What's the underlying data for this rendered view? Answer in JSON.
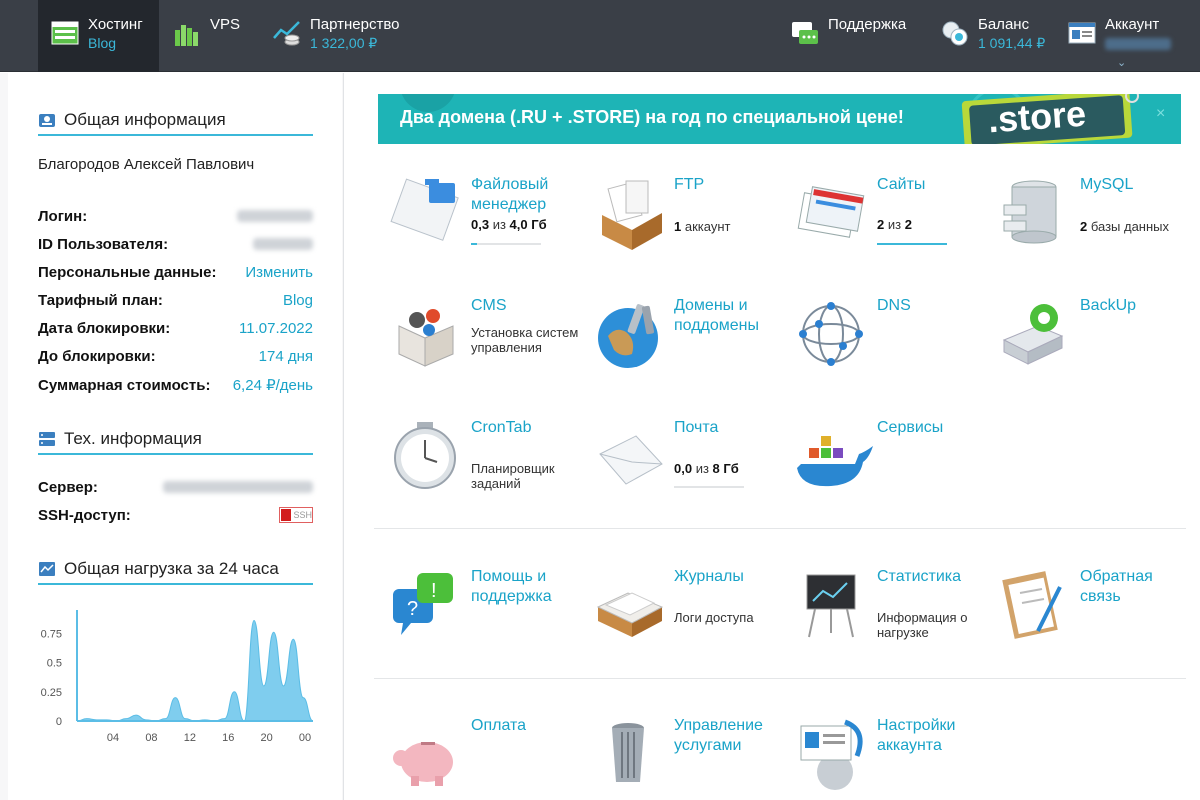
{
  "nav": {
    "hosting": {
      "title": "Хостинг",
      "sub": "Blog"
    },
    "vps": {
      "title": "VPS"
    },
    "partner": {
      "title": "Партнерство",
      "sub": "1 322,00 ₽"
    },
    "support": {
      "title": "Поддержка"
    },
    "balance": {
      "title": "Баланс",
      "sub": "1 091,44 ₽"
    },
    "account": {
      "title": "Аккаунт"
    }
  },
  "general": {
    "title": "Общая информация",
    "owner": "Благородов Алексей Павлович",
    "rows": [
      {
        "label": "Логин:",
        "value": ""
      },
      {
        "label": "ID Пользователя:",
        "value": ""
      },
      {
        "label": "Персональные данные:",
        "value": "Изменить"
      },
      {
        "label": "Тарифный план:",
        "value": "Blog"
      },
      {
        "label": "Дата блокировки:",
        "value": "11.07.2022"
      },
      {
        "label": "До блокировки:",
        "value": "174 дня"
      },
      {
        "label": "Суммарная стоимость:",
        "value": "6,24 ₽/день"
      }
    ]
  },
  "tech": {
    "title": "Тех. информация",
    "server_label": "Сервер:",
    "ssh_label": "SSH-доступ:",
    "ssh_badge": "SSH"
  },
  "load": {
    "title": "Общая нагрузка за 24 часа"
  },
  "chart_data": {
    "type": "area",
    "title": "Общая нагрузка за 24 часа",
    "x_ticks": [
      "04",
      "08",
      "12",
      "16",
      "20",
      "00"
    ],
    "y_ticks": [
      "0",
      "0.25",
      "0.5",
      "0.75"
    ],
    "ylim": [
      0,
      0.95
    ],
    "x": [
      0,
      1,
      2,
      3,
      4,
      5,
      6,
      7,
      8,
      9,
      10,
      11,
      12,
      13,
      14,
      15,
      16,
      17,
      18,
      19,
      20,
      21,
      22,
      23,
      24
    ],
    "values": [
      0,
      0.02,
      0.01,
      0.01,
      0.0,
      0.02,
      0.05,
      0.01,
      0.0,
      0.02,
      0.2,
      0.02,
      0.0,
      0.01,
      0.0,
      0.02,
      0.25,
      0.0,
      0.86,
      0.3,
      0.76,
      0.3,
      0.7,
      0.2,
      0
    ],
    "color": "#7fcdee"
  },
  "banner": {
    "text": "Два домена (.RU + .STORE) на год по специальной цене!",
    "badge": ".store"
  },
  "tiles": [
    {
      "title": "Файловый менеджер",
      "desc_b": "0,3",
      "desc": " из ",
      "desc_b2": "4,0 Гб",
      "usage": 0.08
    },
    {
      "title": "FTP",
      "desc_b": "1",
      "desc": " аккаунт"
    },
    {
      "title": "Сайты",
      "desc_b": "2",
      "desc": " из ",
      "desc_b2": "2",
      "usage": 1.0
    },
    {
      "title": "MySQL",
      "desc_b": "2",
      "desc": " базы данных"
    },
    {
      "title": "CMS",
      "desc": "Установка систем управления"
    },
    {
      "title": "Домены и поддомены"
    },
    {
      "title": "DNS"
    },
    {
      "title": "BackUp"
    },
    {
      "title": "CronTab",
      "desc": "Планировщик заданий"
    },
    {
      "title": "Почта",
      "desc_b": "0,0",
      "desc": " из ",
      "desc_b2": "8 Гб",
      "usage": 0.0
    },
    {
      "title": "Сервисы"
    },
    {
      "title": "Помощь и поддержка"
    },
    {
      "title": "Журналы",
      "desc": "Логи доступа"
    },
    {
      "title": "Статистика",
      "desc": "Информация о нагрузке"
    },
    {
      "title": "Обратная связь"
    },
    {
      "title": "Оплата"
    },
    {
      "title": "Управление услугами"
    },
    {
      "title": "Настройки аккаунта"
    }
  ],
  "colors": {
    "accent": "#3bb8d9",
    "topbar": "#3a3f47",
    "banner": "#1eb4b6"
  },
  "icons": [
    "hosting-icon",
    "vps-icon",
    "partner-icon",
    "support-icon",
    "balance-icon",
    "account-icon"
  ]
}
